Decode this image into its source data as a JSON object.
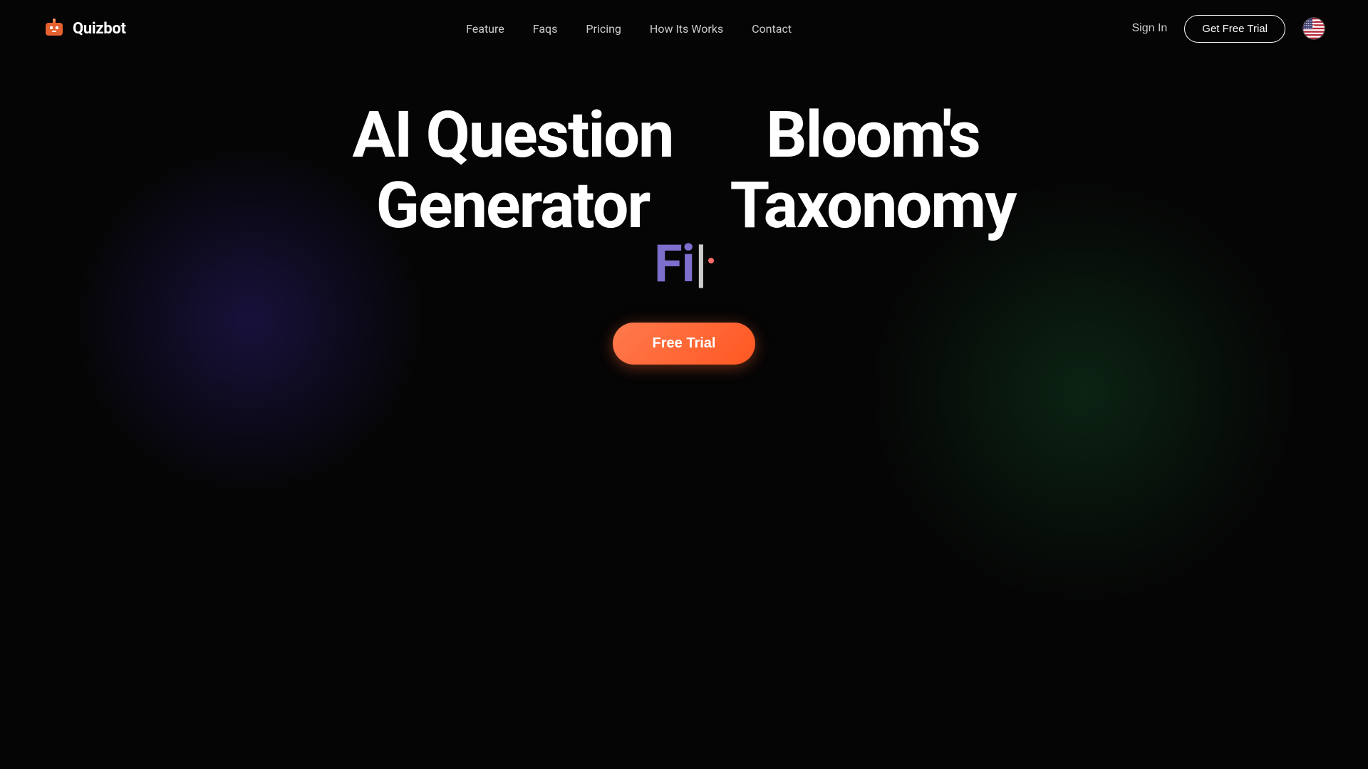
{
  "brand": {
    "name": "Quizbot",
    "logo_alt": "Quizbot logo"
  },
  "nav": {
    "links": [
      {
        "label": "Feature",
        "href": "#"
      },
      {
        "label": "Faqs",
        "href": "#"
      },
      {
        "label": "Pricing",
        "href": "#"
      },
      {
        "label": "How Its Works",
        "href": "#"
      },
      {
        "label": "Contact",
        "href": "#"
      }
    ],
    "sign_in_label": "Sign In",
    "get_free_trial_label": "Get Free Trial"
  },
  "hero": {
    "title_left_line1": "AI Question",
    "title_left_line2": "Generator",
    "title_right_line1": "Bloom's",
    "title_right_line2": "Taxonomy",
    "animated_text": "Fi",
    "free_trial_label": "Free Trial"
  },
  "colors": {
    "accent_orange": "#ff6b35",
    "accent_purple": "#7c6fcd",
    "bg": "#050505",
    "text_primary": "#ffffff",
    "text_secondary": "#cccccc"
  }
}
